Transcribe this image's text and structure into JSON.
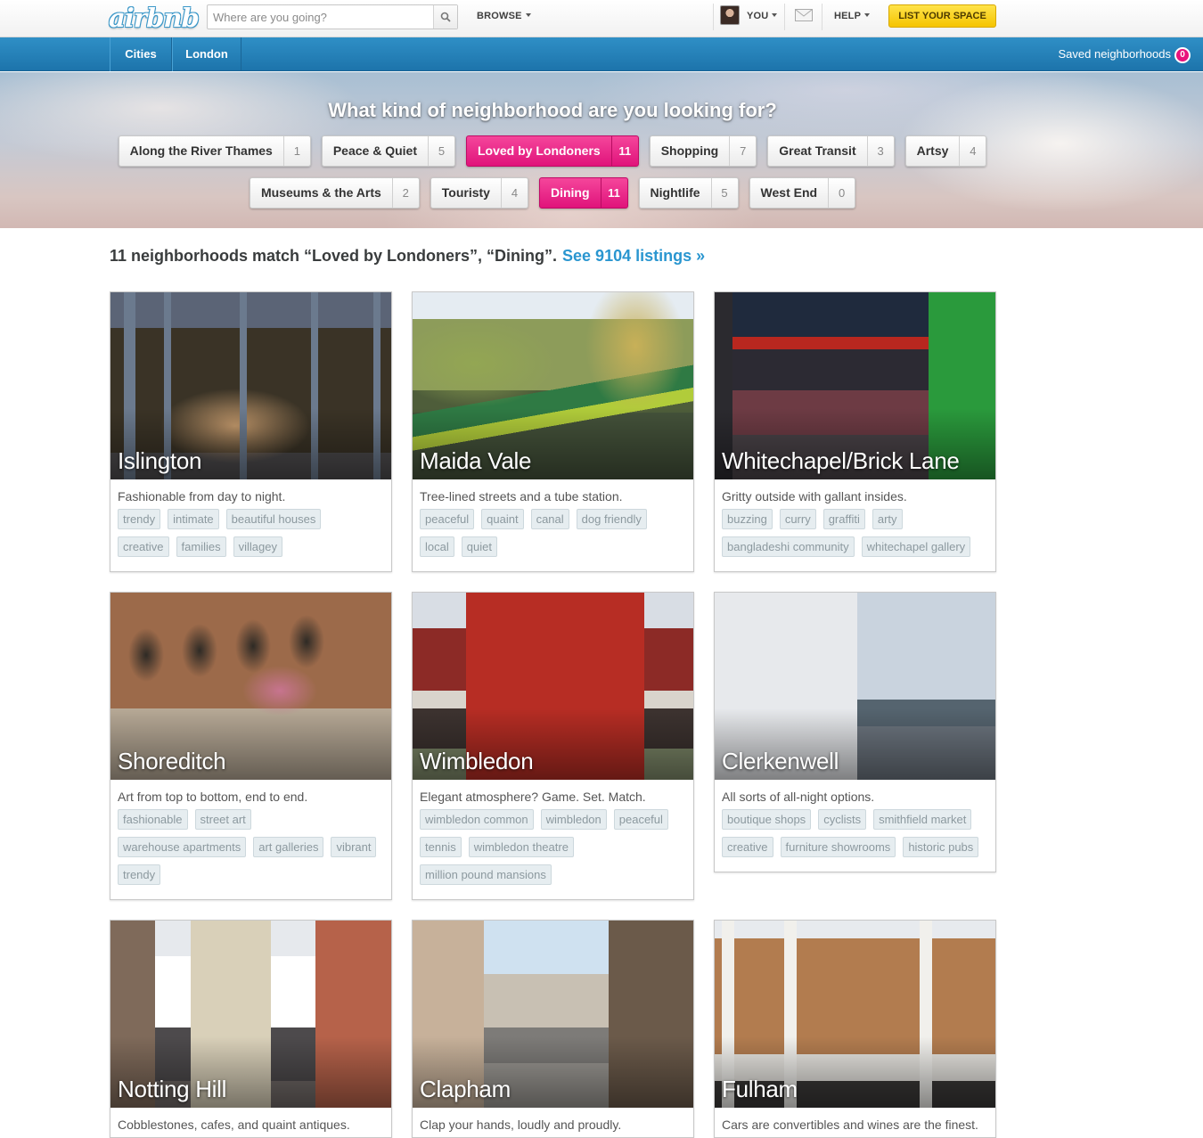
{
  "header": {
    "logo": "airbnb",
    "search_placeholder": "Where are you going?",
    "browse": "BROWSE",
    "you": "YOU",
    "help": "HELP",
    "list_space": "LIST YOUR SPACE"
  },
  "subnav": {
    "items": [
      "Cities",
      "London"
    ],
    "saved_label": "Saved neighborhoods",
    "saved_count": "0"
  },
  "hero": {
    "title": "What kind of neighborhood are you looking for?",
    "row1": [
      {
        "label": "Along the River Thames",
        "count": "1",
        "active": false
      },
      {
        "label": "Peace & Quiet",
        "count": "5",
        "active": false
      },
      {
        "label": "Loved by Londoners",
        "count": "11",
        "active": true
      },
      {
        "label": "Shopping",
        "count": "7",
        "active": false
      },
      {
        "label": "Great Transit",
        "count": "3",
        "active": false
      },
      {
        "label": "Artsy",
        "count": "4",
        "active": false
      }
    ],
    "row2": [
      {
        "label": "Museums & the Arts",
        "count": "2",
        "active": false
      },
      {
        "label": "Touristy",
        "count": "4",
        "active": false
      },
      {
        "label": "Dining",
        "count": "11",
        "active": true
      },
      {
        "label": "Nightlife",
        "count": "5",
        "active": false
      },
      {
        "label": "West End",
        "count": "0",
        "active": false
      }
    ]
  },
  "results": {
    "summary": "11 neighborhoods match “Loved by Londoners”, “Dining”.",
    "see_listings": "See 9104 listings »"
  },
  "neighborhoods": [
    {
      "name": "Islington",
      "desc": "Fashionable from day to night.",
      "tags": [
        "trendy",
        "intimate",
        "beautiful houses",
        "creative",
        "families",
        "villagey"
      ]
    },
    {
      "name": "Maida Vale",
      "desc": "Tree-lined streets and a tube station.",
      "tags": [
        "peaceful",
        "quaint",
        "canal",
        "dog friendly",
        "local",
        "quiet"
      ]
    },
    {
      "name": "Whitechapel/Brick Lane",
      "desc": "Gritty outside with gallant insides.",
      "tags": [
        "buzzing",
        "curry",
        "graffiti",
        "arty",
        "bangladeshi community",
        "whitechapel gallery"
      ]
    },
    {
      "name": "Shoreditch",
      "desc": "Art from top to bottom, end to end.",
      "tags": [
        "fashionable",
        "street art",
        "warehouse apartments",
        "art galleries",
        "vibrant",
        "trendy"
      ]
    },
    {
      "name": "Wimbledon",
      "desc": "Elegant atmosphere? Game. Set. Match.",
      "tags": [
        "wimbledon common",
        "wimbledon",
        "peaceful",
        "tennis",
        "wimbledon theatre",
        "million pound mansions"
      ]
    },
    {
      "name": "Clerkenwell",
      "desc": "All sorts of all-night options.",
      "tags": [
        "boutique shops",
        "cyclists",
        "smithfield market",
        "creative",
        "furniture showrooms",
        "historic pubs"
      ]
    },
    {
      "name": "Notting Hill",
      "desc": "Cobblestones, cafes, and quaint antiques.",
      "tags": []
    },
    {
      "name": "Clapham",
      "desc": "Clap your hands, loudly and proudly.",
      "tags": []
    },
    {
      "name": "Fulham",
      "desc": "Cars are convertibles and wines are the finest.",
      "tags": []
    }
  ],
  "colors": {
    "brand_blue": "#1d74ab",
    "active_pink": "#e0137b",
    "cta_yellow": "#f5c400",
    "link_blue": "#2a96d0"
  }
}
